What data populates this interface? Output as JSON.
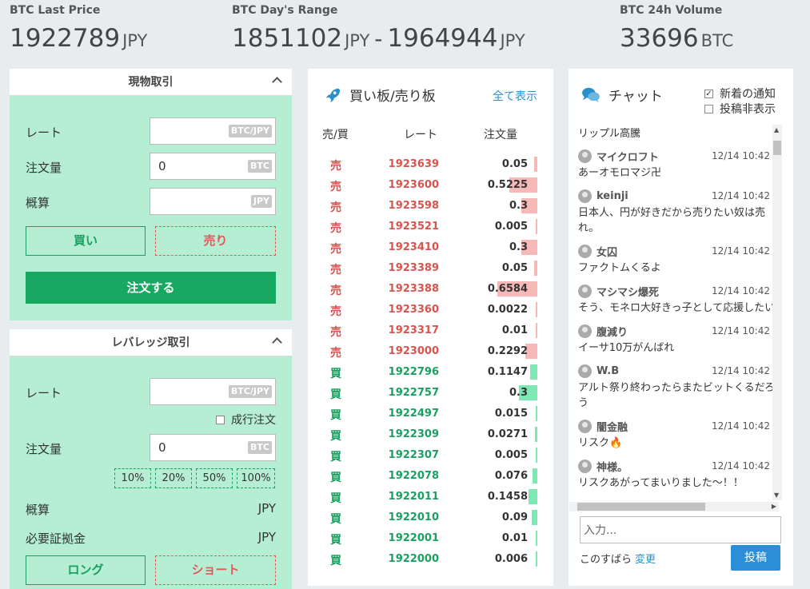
{
  "header": {
    "last_price": {
      "label": "BTC Last Price",
      "value": "1922789",
      "unit": "JPY"
    },
    "day_range": {
      "label": "BTC Day's Range",
      "low": "1851102",
      "low_unit": "JPY",
      "sep": "-",
      "high": "1964944",
      "high_unit": "JPY"
    },
    "volume": {
      "label": "BTC 24h Volume",
      "value": "33696",
      "unit": "BTC"
    }
  },
  "spot": {
    "title": "現物取引",
    "rate_label": "レート",
    "rate_badge": "BTC/JPY",
    "qty_label": "注文量",
    "qty_value": "0",
    "qty_badge": "BTC",
    "est_label": "概算",
    "est_badge": "JPY",
    "buy_label": "買い",
    "sell_label": "売り",
    "order_label": "注文する"
  },
  "leverage": {
    "title": "レバレッジ取引",
    "rate_label": "レート",
    "rate_badge": "BTC/JPY",
    "market_order_label": "成行注文",
    "qty_label": "注文量",
    "qty_value": "0",
    "qty_badge": "BTC",
    "pcts": [
      "10%",
      "20%",
      "50%",
      "100%"
    ],
    "est_label": "概算",
    "est_unit": "JPY",
    "margin_label": "必要証拠金",
    "margin_unit": "JPY",
    "long_label": "ロング",
    "short_label": "ショート"
  },
  "orderbook": {
    "title": "買い板/売り板",
    "show_all": "全て表示",
    "col_side": "売/買",
    "col_rate": "レート",
    "col_qty": "注文量",
    "rows": [
      {
        "side": "売",
        "type": "sell",
        "price": "1923639",
        "amount": "0.05",
        "level": 0.08
      },
      {
        "side": "売",
        "type": "sell",
        "price": "1923600",
        "amount": "0.5225",
        "level": 0.7
      },
      {
        "side": "売",
        "type": "sell",
        "price": "1923598",
        "amount": "0.3",
        "level": 0.4
      },
      {
        "side": "売",
        "type": "sell",
        "price": "1923521",
        "amount": "0.005",
        "level": 0.02
      },
      {
        "side": "売",
        "type": "sell",
        "price": "1923410",
        "amount": "0.3",
        "level": 0.4
      },
      {
        "side": "売",
        "type": "sell",
        "price": "1923389",
        "amount": "0.05",
        "level": 0.08
      },
      {
        "side": "売",
        "type": "sell",
        "price": "1923388",
        "amount": "0.6584",
        "level": 1.0
      },
      {
        "side": "売",
        "type": "sell",
        "price": "1923360",
        "amount": "0.0022",
        "level": 0.01
      },
      {
        "side": "売",
        "type": "sell",
        "price": "1923317",
        "amount": "0.01",
        "level": 0.02
      },
      {
        "side": "売",
        "type": "sell",
        "price": "1923000",
        "amount": "0.2292",
        "level": 0.3
      },
      {
        "side": "買",
        "type": "buy",
        "price": "1922796",
        "amount": "0.1147",
        "level": 0.18
      },
      {
        "side": "買",
        "type": "buy",
        "price": "1922757",
        "amount": "0.3",
        "level": 0.45
      },
      {
        "side": "買",
        "type": "buy",
        "price": "1922497",
        "amount": "0.015",
        "level": 0.03
      },
      {
        "side": "買",
        "type": "buy",
        "price": "1922309",
        "amount": "0.0271",
        "level": 0.05
      },
      {
        "side": "買",
        "type": "buy",
        "price": "1922307",
        "amount": "0.005",
        "level": 0.02
      },
      {
        "side": "買",
        "type": "buy",
        "price": "1922078",
        "amount": "0.076",
        "level": 0.12
      },
      {
        "side": "買",
        "type": "buy",
        "price": "1922011",
        "amount": "0.1458",
        "level": 0.22
      },
      {
        "side": "買",
        "type": "buy",
        "price": "1922010",
        "amount": "0.09",
        "level": 0.14
      },
      {
        "side": "買",
        "type": "buy",
        "price": "1922001",
        "amount": "0.01",
        "level": 0.02
      },
      {
        "side": "買",
        "type": "buy",
        "price": "1922000",
        "amount": "0.006",
        "level": 0.02
      }
    ]
  },
  "chat": {
    "title": "チャット",
    "notify_label": "新着の通知",
    "hide_label": "投稿非表示",
    "first_line": "リップル高騰",
    "messages": [
      {
        "user": "マイクロフト",
        "time": "12/14 10:42",
        "text": "あーオモロマジ卍"
      },
      {
        "user": "keinji",
        "time": "12/14 10:42",
        "text": "日本人、円が好きだから売りたい奴は売れ。"
      },
      {
        "user": "女囚",
        "time": "12/14 10:42",
        "text": "ファクトムくるよ"
      },
      {
        "user": "マシマシ爆死",
        "time": "12/14 10:42",
        "text": "そう、モネロ大好きっ子として応援したい"
      },
      {
        "user": "腹減り",
        "time": "12/14 10:42",
        "text": "イーサ10万がんばれ"
      },
      {
        "user": "W.B",
        "time": "12/14 10:42",
        "text": "アルト祭り終わったらまたビットくるだろう"
      },
      {
        "user": "闇金融",
        "time": "12/14 10:42",
        "text": "リスク🔥"
      },
      {
        "user": "神様。",
        "time": "12/14 10:42",
        "text": "リスクあがってまいりました～！！"
      }
    ],
    "input_placeholder": "入力...",
    "nickname": "このすばら",
    "change_label": "変更",
    "post_label": "投稿"
  }
}
